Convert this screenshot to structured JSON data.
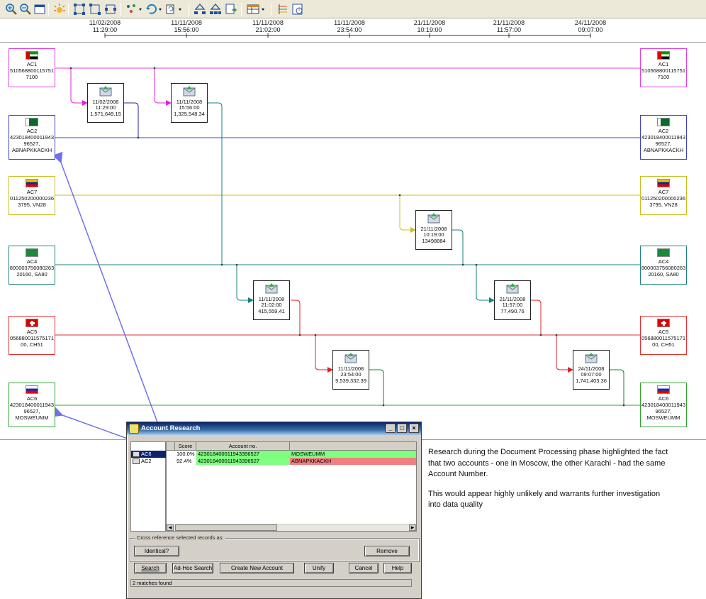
{
  "timeline": {
    "ticks": [
      {
        "date": "11/02/2008",
        "time": "11:29:00"
      },
      {
        "date": "11/11/2008",
        "time": "15:56:00"
      },
      {
        "date": "11/11/2008",
        "time": "21:02:00"
      },
      {
        "date": "11/11/2008",
        "time": "23:54:00"
      },
      {
        "date": "21/11/2008",
        "time": "10:19:00"
      },
      {
        "date": "21/11/2008",
        "time": "11:57:00"
      },
      {
        "date": "24/11/2008",
        "time": "09:07:00"
      }
    ]
  },
  "accounts": [
    {
      "name": "AC1",
      "line1": "510568800115751",
      "line2": "7100",
      "line3": "",
      "color": "#e040e0",
      "flag": "uae"
    },
    {
      "name": "AC2",
      "line1": "423018400011943",
      "line2": "96527,",
      "line3": "ABNAPKKACKH",
      "color": "#4040c0",
      "flag": "pakistan"
    },
    {
      "name": "AC7",
      "line1": "011250200000236",
      "line2": "3795, VN28",
      "line3": "",
      "color": "#c8c020",
      "flag": "venezuela"
    },
    {
      "name": "AC4",
      "line1": "800003756080263",
      "line2": "20160, SA80",
      "line3": "",
      "color": "#208080",
      "flag": "saudi"
    },
    {
      "name": "AC5",
      "line1": "056880011575171",
      "line2": "00, CH51",
      "line3": "",
      "color": "#e03030",
      "flag": "swiss"
    },
    {
      "name": "AC6",
      "line1": "423018400011943",
      "line2": "96527,",
      "line3": "MOSWEUMM",
      "color": "#30a030",
      "flag": "russia"
    }
  ],
  "transactions": [
    {
      "date": "11/02/2008",
      "time": "11:29:00",
      "amount": "1,571,649.15"
    },
    {
      "date": "11/11/2008",
      "time": "15:56:00",
      "amount": "1,325,548.34"
    },
    {
      "date": "21/11/2008",
      "time": "10:19:00",
      "amount": "13498884"
    },
    {
      "date": "11/11/2008",
      "time": "21:02:00",
      "amount": "415,559.41"
    },
    {
      "date": "21/11/2008",
      "time": "11:57:00",
      "amount": "77,490.76"
    },
    {
      "date": "11/11/2008",
      "time": "23:54:00",
      "amount": "9,539,332.39"
    },
    {
      "date": "24/11/2008",
      "time": "09:07:00",
      "amount": "1,741,403.36"
    }
  ],
  "note": {
    "para1": "Research during the Document Processing phase highlighted the fact that two accounts - one in Moscow, the other Karachi - had the same Account Number.",
    "para2": "This would appear highly unlikely and warrants further investigation into data quality"
  },
  "dialog": {
    "title": "Account Research",
    "min": "_",
    "max": "□",
    "close": "×",
    "headers": {
      "score": "Score",
      "account": "Account no."
    },
    "rows": [
      {
        "id": "AC6",
        "score": "100.0%",
        "account": "423018400011943396527",
        "name": "MOSWEUMM",
        "name_color": "#80ff80"
      },
      {
        "id": "AC2",
        "score": "92.4%",
        "account": "423018400011943396527",
        "name": "ABNAPKKACKH",
        "name_color": "#f08080"
      }
    ],
    "group_label": "Cross reference selected records as:",
    "buttons": {
      "identical": "Identical?",
      "remove": "Remove",
      "search": "Search",
      "adhoc": "Ad-Hoc Search",
      "create": "Create New Account",
      "unify": "Unify",
      "cancel": "Cancel",
      "help": "Help"
    },
    "status": "2 matches found"
  }
}
